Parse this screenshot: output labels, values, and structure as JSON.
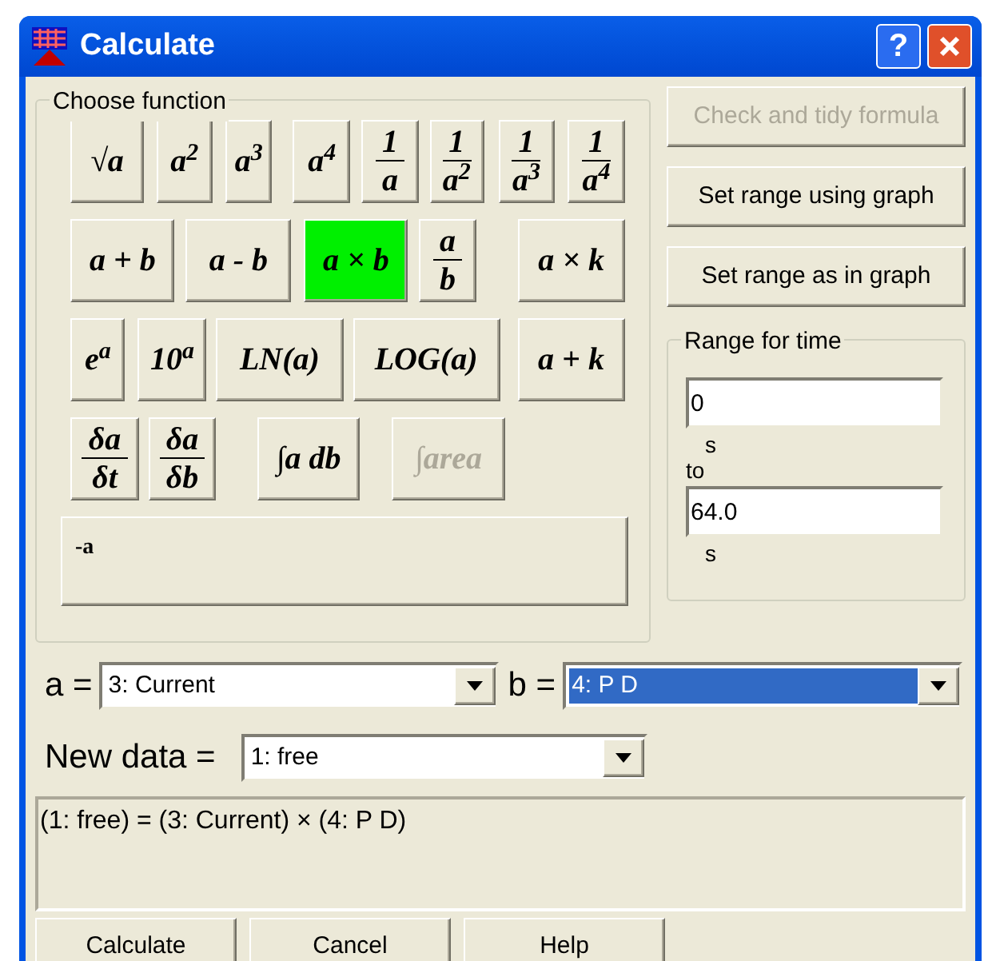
{
  "window": {
    "title": "Calculate",
    "help_button": "?"
  },
  "function_group": {
    "label": "Choose function",
    "rows": [
      [
        {
          "kind": "plain",
          "text": "√a",
          "selected": false,
          "disabled": false
        },
        {
          "kind": "plain",
          "text": "a$^{2}$",
          "selected": false,
          "disabled": false
        },
        {
          "kind": "plain",
          "text": "a$^{3}$",
          "selected": false,
          "disabled": false
        },
        {
          "kind": "plain",
          "text": "a$^{4}$",
          "selected": false,
          "disabled": false
        },
        {
          "kind": "fraction",
          "numerator": "1",
          "denominator": "a",
          "selected": false,
          "disabled": false
        },
        {
          "kind": "fraction",
          "numerator": "1",
          "denominator": "a$^{2}$",
          "selected": false,
          "disabled": false
        },
        {
          "kind": "fraction",
          "numerator": "1",
          "denominator": "a$^{3}$",
          "selected": false,
          "disabled": false
        },
        {
          "kind": "fraction",
          "numerator": "1",
          "denominator": "a$^{4}$",
          "selected": false,
          "disabled": false
        }
      ],
      [
        {
          "kind": "plain",
          "text": "a + b",
          "selected": false,
          "disabled": false
        },
        {
          "kind": "plain",
          "text": "a - b",
          "selected": false,
          "disabled": false
        },
        {
          "kind": "plain",
          "text": "a × b",
          "selected": true,
          "disabled": false
        },
        {
          "kind": "fraction",
          "numerator": "a",
          "denominator": "b",
          "selected": false,
          "disabled": false
        },
        {
          "kind": "plain",
          "text": "a × k",
          "selected": false,
          "disabled": false
        }
      ],
      [
        {
          "kind": "plain",
          "text": "e$^{a}$",
          "selected": false,
          "disabled": false
        },
        {
          "kind": "plain",
          "text": "10$^{a}$",
          "selected": false,
          "disabled": false
        },
        {
          "kind": "plain",
          "text": "LN(a)",
          "selected": false,
          "disabled": false
        },
        {
          "kind": "plain",
          "text": "LOG(a)",
          "selected": false,
          "disabled": false
        },
        {
          "kind": "plain",
          "text": "a + k",
          "selected": false,
          "disabled": false
        }
      ],
      [
        {
          "kind": "fraction",
          "numerator": "δa",
          "denominator": "δt",
          "selected": false,
          "disabled": false
        },
        {
          "kind": "fraction",
          "numerator": "δa",
          "denominator": "δb",
          "selected": false,
          "disabled": false
        },
        {
          "kind": "plain",
          "text": "∫a db",
          "selected": false,
          "disabled": false
        },
        {
          "kind": "plain",
          "text": "∫area",
          "selected": false,
          "disabled": true
        }
      ]
    ],
    "custom_button": "-a"
  },
  "side_buttons": [
    {
      "label": "Check and tidy formula",
      "disabled": true
    },
    {
      "label": "Set range using graph",
      "disabled": false
    },
    {
      "label": "Set range as in graph",
      "disabled": false
    }
  ],
  "range": {
    "label": "Range for time",
    "from": {
      "value": "0",
      "unit": "s"
    },
    "to_label": "to",
    "to": {
      "value": "64.0",
      "unit": "s"
    }
  },
  "selectors": [
    {
      "label": "a =",
      "value": "3: Current",
      "selected": false
    },
    {
      "label": "b =",
      "value": "4: P D",
      "selected": true
    }
  ],
  "new_data": {
    "label": "New data =",
    "value": "1: free"
  },
  "formula": "(1: free) = (3: Current) × (4: P D)",
  "buttons": [
    "Calculate",
    "Cancel",
    "Help"
  ]
}
